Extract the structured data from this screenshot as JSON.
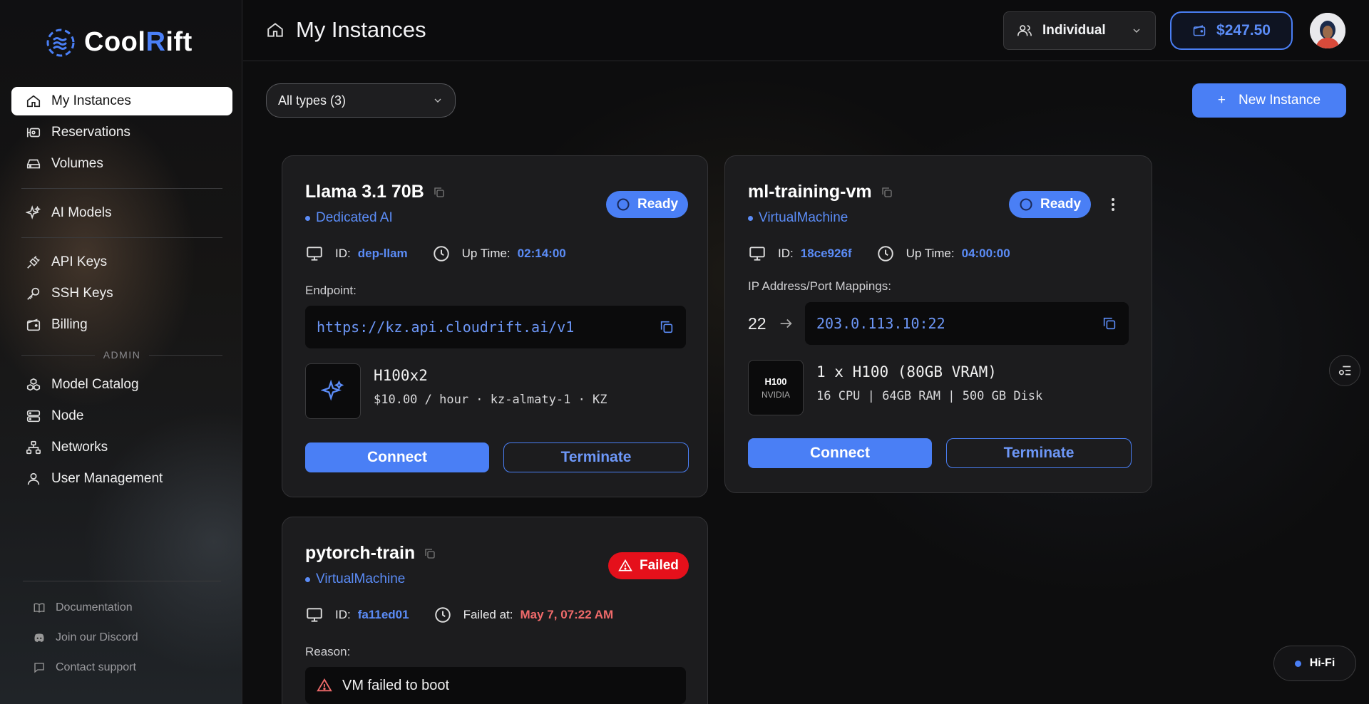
{
  "brand": {
    "name_part1": "Cool",
    "name_r": "R",
    "name_part2": "ift"
  },
  "sidebar": {
    "items": [
      {
        "label": "My Instances",
        "icon": "home-icon"
      },
      {
        "label": "Reservations",
        "icon": "reservations-icon"
      },
      {
        "label": "Volumes",
        "icon": "volumes-icon"
      },
      {
        "label": "AI Models",
        "icon": "sparkles-icon"
      },
      {
        "label": "API Keys",
        "icon": "plug-icon"
      },
      {
        "label": "SSH Keys",
        "icon": "key-icon"
      },
      {
        "label": "Billing",
        "icon": "wallet-icon"
      }
    ],
    "admin_label": "ADMIN",
    "admin_items": [
      {
        "label": "Model Catalog",
        "icon": "boxes-icon"
      },
      {
        "label": "Node",
        "icon": "server-icon"
      },
      {
        "label": "Networks",
        "icon": "network-icon"
      },
      {
        "label": "User Management",
        "icon": "user-icon"
      }
    ],
    "footer": [
      {
        "label": "Documentation",
        "icon": "book-icon"
      },
      {
        "label": "Join our Discord",
        "icon": "discord-icon"
      },
      {
        "label": "Contact support",
        "icon": "chat-icon"
      }
    ]
  },
  "header": {
    "title": "My Instances",
    "account_type": "Individual",
    "balance": "$247.50"
  },
  "toolbar": {
    "filter_label": "All types (3)",
    "new_button": "New Instance",
    "new_button_icon_text": "+"
  },
  "instances": [
    {
      "name": "Llama 3.1 70B",
      "type": "Dedicated AI",
      "status": "Ready",
      "id_label": "ID:",
      "id": "dep-llam",
      "time_label": "Up Time:",
      "time": "02:14:00",
      "section_label": "Endpoint:",
      "endpoint": "https://kz.api.cloudrift.ai/v1",
      "hw_name": "H100x2",
      "hw_spec": "$10.00 / hour · kz-almaty-1 · KZ",
      "connect": "Connect",
      "terminate": "Terminate"
    },
    {
      "name": "ml-training-vm",
      "type": "VirtualMachine",
      "status": "Ready",
      "id_label": "ID:",
      "id": "18ce926f",
      "time_label": "Up Time:",
      "time": "04:00:00",
      "section_label": "IP Address/Port Mappings:",
      "port": "22",
      "endpoint": "203.0.113.10:22",
      "tile_top": "H100",
      "tile_bottom": "NVIDIA",
      "hw_name": "1 x H100 (80GB VRAM)",
      "hw_spec": "16 CPU | 64GB RAM | 500 GB Disk",
      "connect": "Connect",
      "terminate": "Terminate"
    },
    {
      "name": "pytorch-train",
      "type": "VirtualMachine",
      "status": "Failed",
      "id_label": "ID:",
      "id": "fa11ed01",
      "time_label": "Failed at:",
      "time": "May 7, 07:22 AM",
      "section_label": "Reason:",
      "reason": "VM failed to boot"
    }
  ],
  "widgets": {
    "hifi": "Hi-Fi"
  },
  "colors": {
    "accent": "#4a7ff5",
    "danger": "#e5101b",
    "bg": "#0d0d0e"
  }
}
